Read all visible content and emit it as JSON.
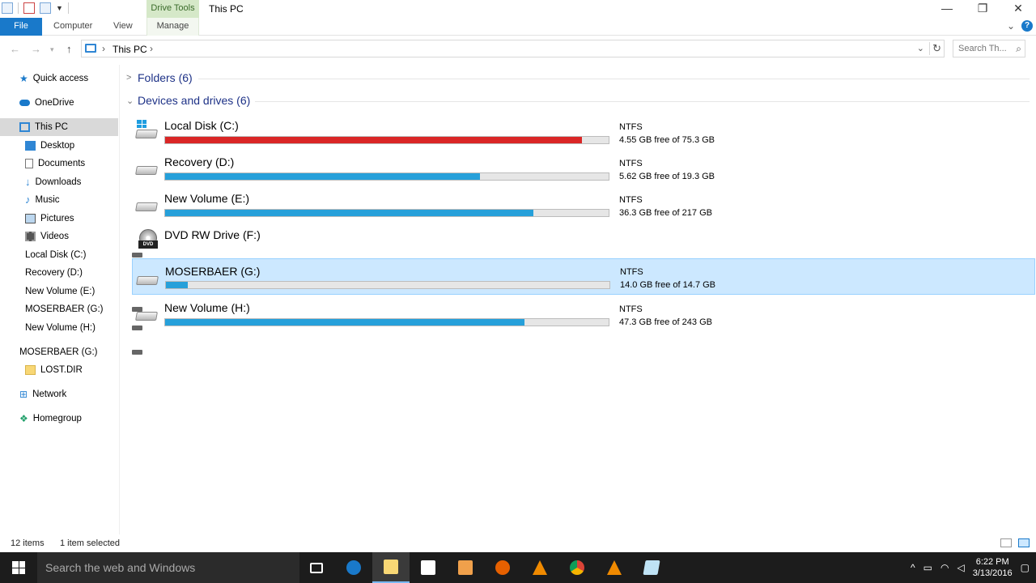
{
  "window": {
    "title": "This PC",
    "contextual_tab_group": "Drive Tools",
    "controls": {
      "minimize": "—",
      "restore": "❐",
      "close": "✕"
    }
  },
  "ribbon": {
    "tabs": {
      "file": "File",
      "computer": "Computer",
      "view": "View",
      "manage": "Manage"
    },
    "help": "?",
    "expand": "⌄"
  },
  "address": {
    "crumb": "This PC",
    "sep1": "›",
    "sep2": "›",
    "dropdown": "⌄",
    "refresh": "↻"
  },
  "search": {
    "placeholder": "Search Th..."
  },
  "navigation": {
    "quick_access": "Quick access",
    "onedrive": "OneDrive",
    "this_pc": "This PC",
    "desktop": "Desktop",
    "documents": "Documents",
    "downloads": "Downloads",
    "music": "Music",
    "pictures": "Pictures",
    "videos": "Videos",
    "local_disk_c": "Local Disk (C:)",
    "recovery_d": "Recovery (D:)",
    "new_volume_e": "New Volume (E:)",
    "moserbaer_g": "MOSERBAER (G:)",
    "new_volume_h": "New Volume (H:)",
    "moserbaer_g_root": "MOSERBAER (G:)",
    "lost_dir": "LOST.DIR",
    "network": "Network",
    "homegroup": "Homegroup"
  },
  "groups": {
    "folders": "Folders (6)",
    "devices": "Devices and drives (6)"
  },
  "drives": [
    {
      "name": "Local Disk (C:)",
      "fs": "NTFS",
      "free": "4.55 GB free of 75.3 GB",
      "used_fraction": 0.94,
      "status_color": "#da2626"
    },
    {
      "name": "Recovery (D:)",
      "fs": "NTFS",
      "free": "5.62 GB free of 19.3 GB",
      "used_fraction": 0.71
    },
    {
      "name": "New Volume (E:)",
      "fs": "NTFS",
      "free": "36.3 GB free of 217 GB",
      "used_fraction": 0.83
    },
    {
      "name": "DVD RW Drive (F:)",
      "dvd_label": "DVD"
    },
    {
      "name": "MOSERBAER (G:)",
      "fs": "NTFS",
      "free": "14.0 GB free of 14.7 GB",
      "used_fraction": 0.05
    },
    {
      "name": "New Volume (H:)",
      "fs": "NTFS",
      "free": "47.3 GB free of 243 GB",
      "used_fraction": 0.81
    }
  ],
  "status": {
    "item_count": "12 items",
    "selection": "1 item selected"
  },
  "taskbar": {
    "search_placeholder": "Search the web and Windows",
    "time": "6:22 PM",
    "date": "3/13/2016",
    "tray_chevron": "^"
  },
  "colors": {
    "accent": "#1979ca",
    "drive_bar": "#26a0da",
    "drive_bar_full": "#da2626",
    "selection": "#cce8ff"
  }
}
